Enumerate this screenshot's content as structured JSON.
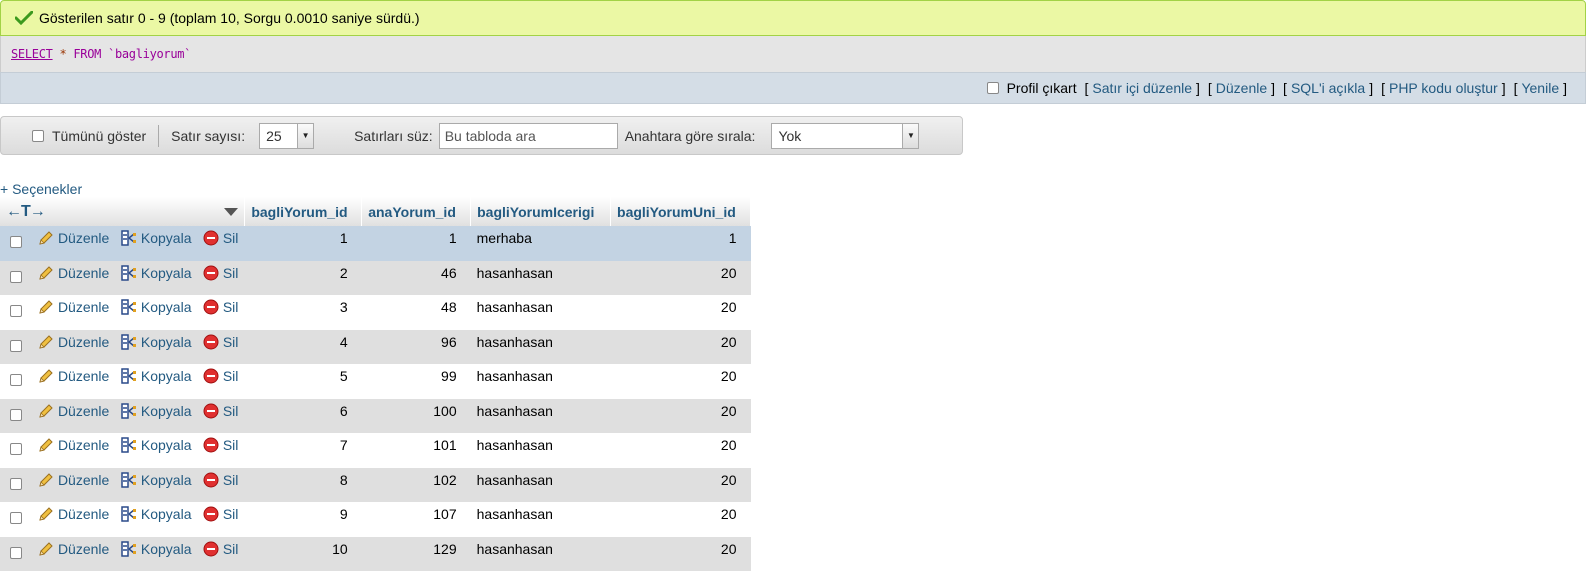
{
  "status": {
    "message": "Gösterilen satır 0 - 9 (toplam 10, Sorgu 0.0010 saniye sürdü.)",
    "color": "#ebf8a4"
  },
  "sql": {
    "select": "SELECT",
    "star": "*",
    "from": "FROM",
    "table": "`bagliyorum`"
  },
  "links": {
    "profile_label": "Profil çıkart",
    "inline_edit": "Satır içi düzenle",
    "edit": "Düzenle",
    "explain": "SQL'i açıkla",
    "php_code": "PHP kodu oluştur",
    "refresh": "Yenile"
  },
  "nav": {
    "show_all": "Tümünü göster",
    "rows_label": "Satır sayısı:",
    "rows_value": "25",
    "filter_label": "Satırları süz:",
    "filter_placeholder": "Bu tabloda ara",
    "sort_label": "Anahtara göre sırala:",
    "sort_value": "Yok"
  },
  "options_link": "+ Seçenekler",
  "table": {
    "tools_glyph": "←T→",
    "columns": [
      "bagliYorum_id",
      "anaYorum_id",
      "bagliYorumIcerigi",
      "bagliYorumUni_id"
    ],
    "actions": {
      "edit": "Düzenle",
      "copy": "Kopyala",
      "delete": "Sil"
    },
    "rows": [
      {
        "bagliYorum_id": "1",
        "anaYorum_id": "1",
        "bagliYorumIcerigi": "merhaba",
        "bagliYorumUni_id": "1"
      },
      {
        "bagliYorum_id": "2",
        "anaYorum_id": "46",
        "bagliYorumIcerigi": "hasanhasan",
        "bagliYorumUni_id": "20"
      },
      {
        "bagliYorum_id": "3",
        "anaYorum_id": "48",
        "bagliYorumIcerigi": "hasanhasan",
        "bagliYorumUni_id": "20"
      },
      {
        "bagliYorum_id": "4",
        "anaYorum_id": "96",
        "bagliYorumIcerigi": "hasanhasan",
        "bagliYorumUni_id": "20"
      },
      {
        "bagliYorum_id": "5",
        "anaYorum_id": "99",
        "bagliYorumIcerigi": "hasanhasan",
        "bagliYorumUni_id": "20"
      },
      {
        "bagliYorum_id": "6",
        "anaYorum_id": "100",
        "bagliYorumIcerigi": "hasanhasan",
        "bagliYorumUni_id": "20"
      },
      {
        "bagliYorum_id": "7",
        "anaYorum_id": "101",
        "bagliYorumIcerigi": "hasanhasan",
        "bagliYorumUni_id": "20"
      },
      {
        "bagliYorum_id": "8",
        "anaYorum_id": "102",
        "bagliYorumIcerigi": "hasanhasan",
        "bagliYorumUni_id": "20"
      },
      {
        "bagliYorum_id": "9",
        "anaYorum_id": "107",
        "bagliYorumIcerigi": "hasanhasan",
        "bagliYorumUni_id": "20"
      },
      {
        "bagliYorum_id": "10",
        "anaYorum_id": "129",
        "bagliYorumIcerigi": "hasanhasan",
        "bagliYorumUni_id": "20"
      }
    ]
  },
  "icons": {
    "status": "check-icon",
    "edit": "pencil-icon",
    "copy": "copy-icon",
    "delete": "delete-icon",
    "sort": "sort-triangle-icon"
  }
}
